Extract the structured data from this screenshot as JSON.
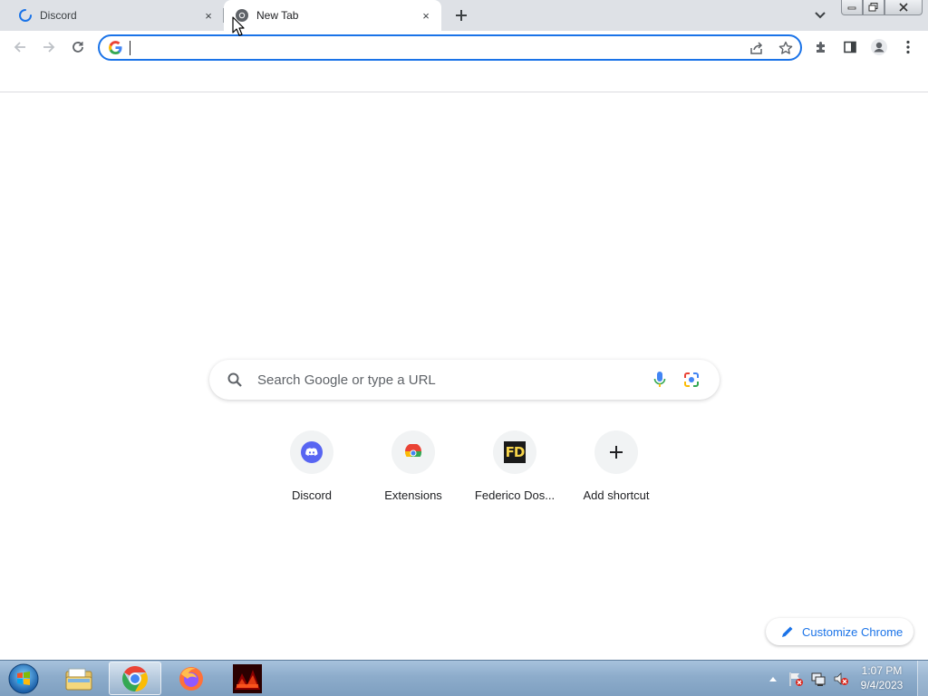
{
  "tabs": [
    {
      "title": "Discord",
      "state": "loading",
      "close_label": "×"
    },
    {
      "title": "New Tab",
      "state": "active",
      "close_label": "×"
    }
  ],
  "new_tab_label": "+",
  "omnibox": {
    "value": "",
    "placeholder": ""
  },
  "ntp": {
    "search_placeholder": "Search Google or type a URL",
    "shortcuts": [
      {
        "label": "Discord",
        "icon": "discord-icon"
      },
      {
        "label": "Extensions",
        "icon": "chrome-web-store-icon"
      },
      {
        "label": "Federico Dos...",
        "icon": "fd-logo-icon",
        "logo_text": "FD"
      },
      {
        "label": "Add shortcut",
        "icon": "plus-icon"
      }
    ],
    "customize_label": "Customize Chrome"
  },
  "taskbar": {
    "items": [
      "windows-explorer-icon",
      "google-chrome-icon",
      "firefox-icon",
      "game-app-icon"
    ],
    "active_item": "google-chrome-icon"
  },
  "clock": {
    "time": "1:07 PM",
    "date": "9/4/2023"
  },
  "colors": {
    "accent": "#1a73e8",
    "tabstrip": "#dee1e6",
    "discord": "#5865f2"
  }
}
